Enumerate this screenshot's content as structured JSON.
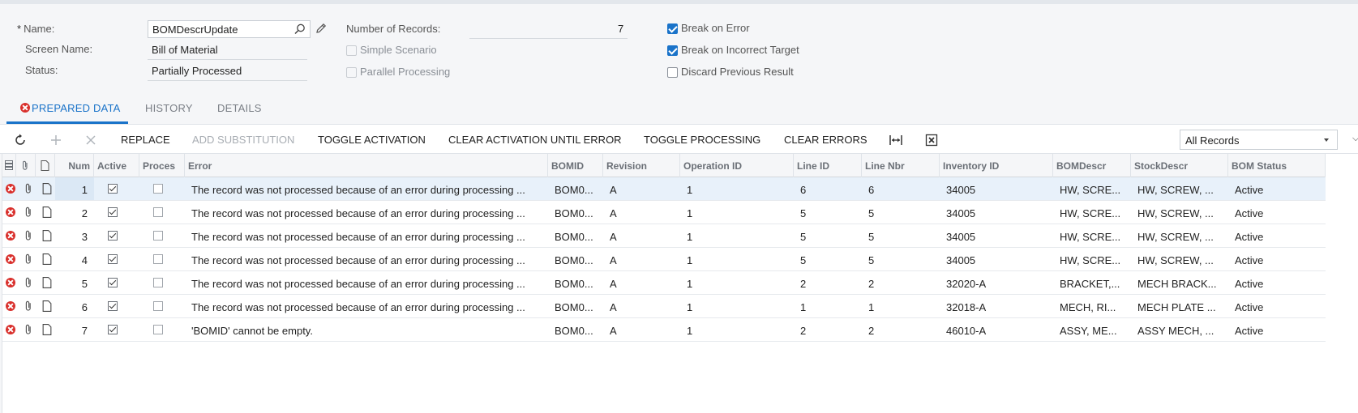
{
  "form": {
    "name_label": "Name:",
    "name_required": "*",
    "name_value": "BOMDescrUpdate",
    "screen_name_label": "Screen Name:",
    "screen_name_value": "Bill of Material",
    "status_label": "Status:",
    "status_value": "Partially Processed",
    "num_records_label": "Number of Records:",
    "num_records_value": "7",
    "simple_scenario_label": "Simple Scenario",
    "parallel_processing_label": "Parallel Processing",
    "break_on_error_label": "Break on Error",
    "break_on_incorrect_target_label": "Break on Incorrect Target",
    "discard_previous_result_label": "Discard Previous Result"
  },
  "checkboxes": {
    "simple_scenario": false,
    "parallel_processing": false,
    "break_on_error": true,
    "break_on_incorrect_target": true,
    "discard_previous_result": false
  },
  "tabs": [
    {
      "label": "PREPARED DATA",
      "active": true
    },
    {
      "label": "HISTORY",
      "active": false
    },
    {
      "label": "DETAILS",
      "active": false
    }
  ],
  "toolbar": {
    "replace": "REPLACE",
    "add_substitution": "ADD SUBSTITUTION",
    "toggle_activation": "TOGGLE ACTIVATION",
    "clear_activation": "CLEAR ACTIVATION UNTIL ERROR",
    "toggle_processing": "TOGGLE PROCESSING",
    "clear_errors": "CLEAR ERRORS",
    "filter_value": "All Records"
  },
  "grid": {
    "columns": [
      "Num",
      "Active",
      "Proces",
      "Error",
      "BOMID",
      "Revision",
      "Operation ID",
      "Line ID",
      "Line Nbr",
      "Inventory ID",
      "BOMDescr",
      "StockDescr",
      "BOM Status"
    ],
    "rows": [
      {
        "num": "1",
        "active": true,
        "processed": false,
        "error": "The record was not processed because of an error during processing ...",
        "bomid": "BOM0...",
        "revision": "A",
        "operation_id": "1",
        "line_id": "6",
        "line_nbr": "6",
        "inventory_id": "34005",
        "bom_descr": "HW, SCRE...",
        "stock_descr": "HW, SCREW, ...",
        "bom_status": "Active"
      },
      {
        "num": "2",
        "active": true,
        "processed": false,
        "error": "The record was not processed because of an error during processing ...",
        "bomid": "BOM0...",
        "revision": "A",
        "operation_id": "1",
        "line_id": "5",
        "line_nbr": "5",
        "inventory_id": "34005",
        "bom_descr": "HW, SCRE...",
        "stock_descr": "HW, SCREW, ...",
        "bom_status": "Active"
      },
      {
        "num": "3",
        "active": true,
        "processed": false,
        "error": "The record was not processed because of an error during processing ...",
        "bomid": "BOM0...",
        "revision": "A",
        "operation_id": "1",
        "line_id": "5",
        "line_nbr": "5",
        "inventory_id": "34005",
        "bom_descr": "HW, SCRE...",
        "stock_descr": "HW, SCREW, ...",
        "bom_status": "Active"
      },
      {
        "num": "4",
        "active": true,
        "processed": false,
        "error": "The record was not processed because of an error during processing ...",
        "bomid": "BOM0...",
        "revision": "A",
        "operation_id": "1",
        "line_id": "5",
        "line_nbr": "5",
        "inventory_id": "34005",
        "bom_descr": "HW, SCRE...",
        "stock_descr": "HW, SCREW, ...",
        "bom_status": "Active"
      },
      {
        "num": "5",
        "active": true,
        "processed": false,
        "error": "The record was not processed because of an error during processing ...",
        "bomid": "BOM0...",
        "revision": "A",
        "operation_id": "1",
        "line_id": "2",
        "line_nbr": "2",
        "inventory_id": "32020-A",
        "bom_descr": "BRACKET,...",
        "stock_descr": "MECH BRACK...",
        "bom_status": "Active"
      },
      {
        "num": "6",
        "active": true,
        "processed": false,
        "error": "The record was not processed because of an error during processing ...",
        "bomid": "BOM0...",
        "revision": "A",
        "operation_id": "1",
        "line_id": "1",
        "line_nbr": "1",
        "inventory_id": "32018-A",
        "bom_descr": "MECH, RI...",
        "stock_descr": "MECH PLATE ...",
        "bom_status": "Active"
      },
      {
        "num": "7",
        "active": true,
        "processed": false,
        "error": "'BOMID' cannot be empty.",
        "bomid": "BOM0...",
        "revision": "A",
        "operation_id": "1",
        "line_id": "2",
        "line_nbr": "2",
        "inventory_id": "46010-A",
        "bom_descr": "ASSY, ME...",
        "stock_descr": "ASSY MECH, ...",
        "bom_status": "Active"
      }
    ]
  },
  "colors": {
    "accent": "#1a73c9",
    "error": "#d9302c",
    "selected_row": "#e8f1fa"
  }
}
